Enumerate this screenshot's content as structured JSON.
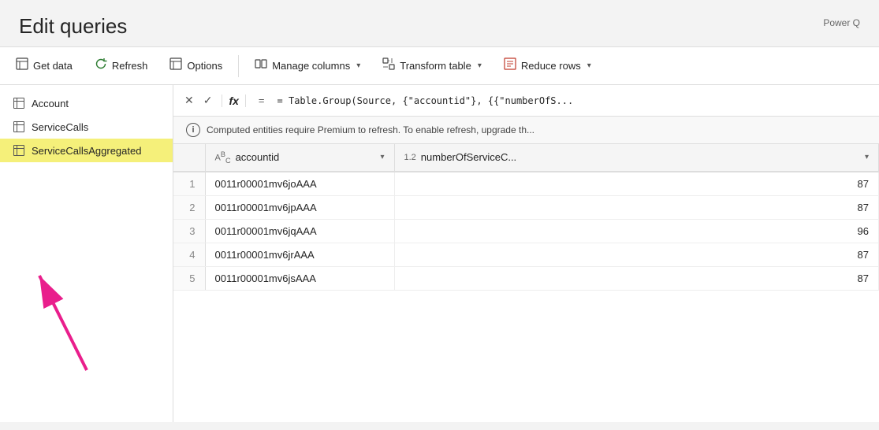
{
  "app": {
    "title": "Edit queries",
    "power_label": "Power Q"
  },
  "toolbar": {
    "get_data_label": "Get data",
    "refresh_label": "Refresh",
    "options_label": "Options",
    "manage_columns_label": "Manage columns",
    "transform_table_label": "Transform table",
    "reduce_rows_label": "Reduce rows"
  },
  "sidebar": {
    "items": [
      {
        "id": "account",
        "label": "Account",
        "active": false
      },
      {
        "id": "service-calls",
        "label": "ServiceCalls",
        "active": false
      },
      {
        "id": "service-calls-aggregated",
        "label": "ServiceCallsAggregated",
        "active": true
      }
    ]
  },
  "formula_bar": {
    "formula": "= Table.Group(Source, {\"accountid\"}, {{\"numberOfS..."
  },
  "info_bar": {
    "message": "Computed entities require Premium to refresh. To enable refresh, upgrade th..."
  },
  "table": {
    "columns": [
      {
        "id": "row-num",
        "label": "",
        "type": ""
      },
      {
        "id": "accountid",
        "label": "accountid",
        "type": "ABC"
      },
      {
        "id": "numberOfServiceC",
        "label": "numberOfServiceC...",
        "type": "1.2"
      }
    ],
    "rows": [
      {
        "num": "1",
        "accountid": "0011r00001mv6joAAA",
        "value": "87"
      },
      {
        "num": "2",
        "accountid": "0011r00001mv6jpAAA",
        "value": "87"
      },
      {
        "num": "3",
        "accountid": "0011r00001mv6jqAAA",
        "value": "96"
      },
      {
        "num": "4",
        "accountid": "0011r00001mv6jrAAA",
        "value": "87"
      },
      {
        "num": "5",
        "accountid": "0011r00001mv6jsAAA",
        "value": "87"
      }
    ]
  }
}
